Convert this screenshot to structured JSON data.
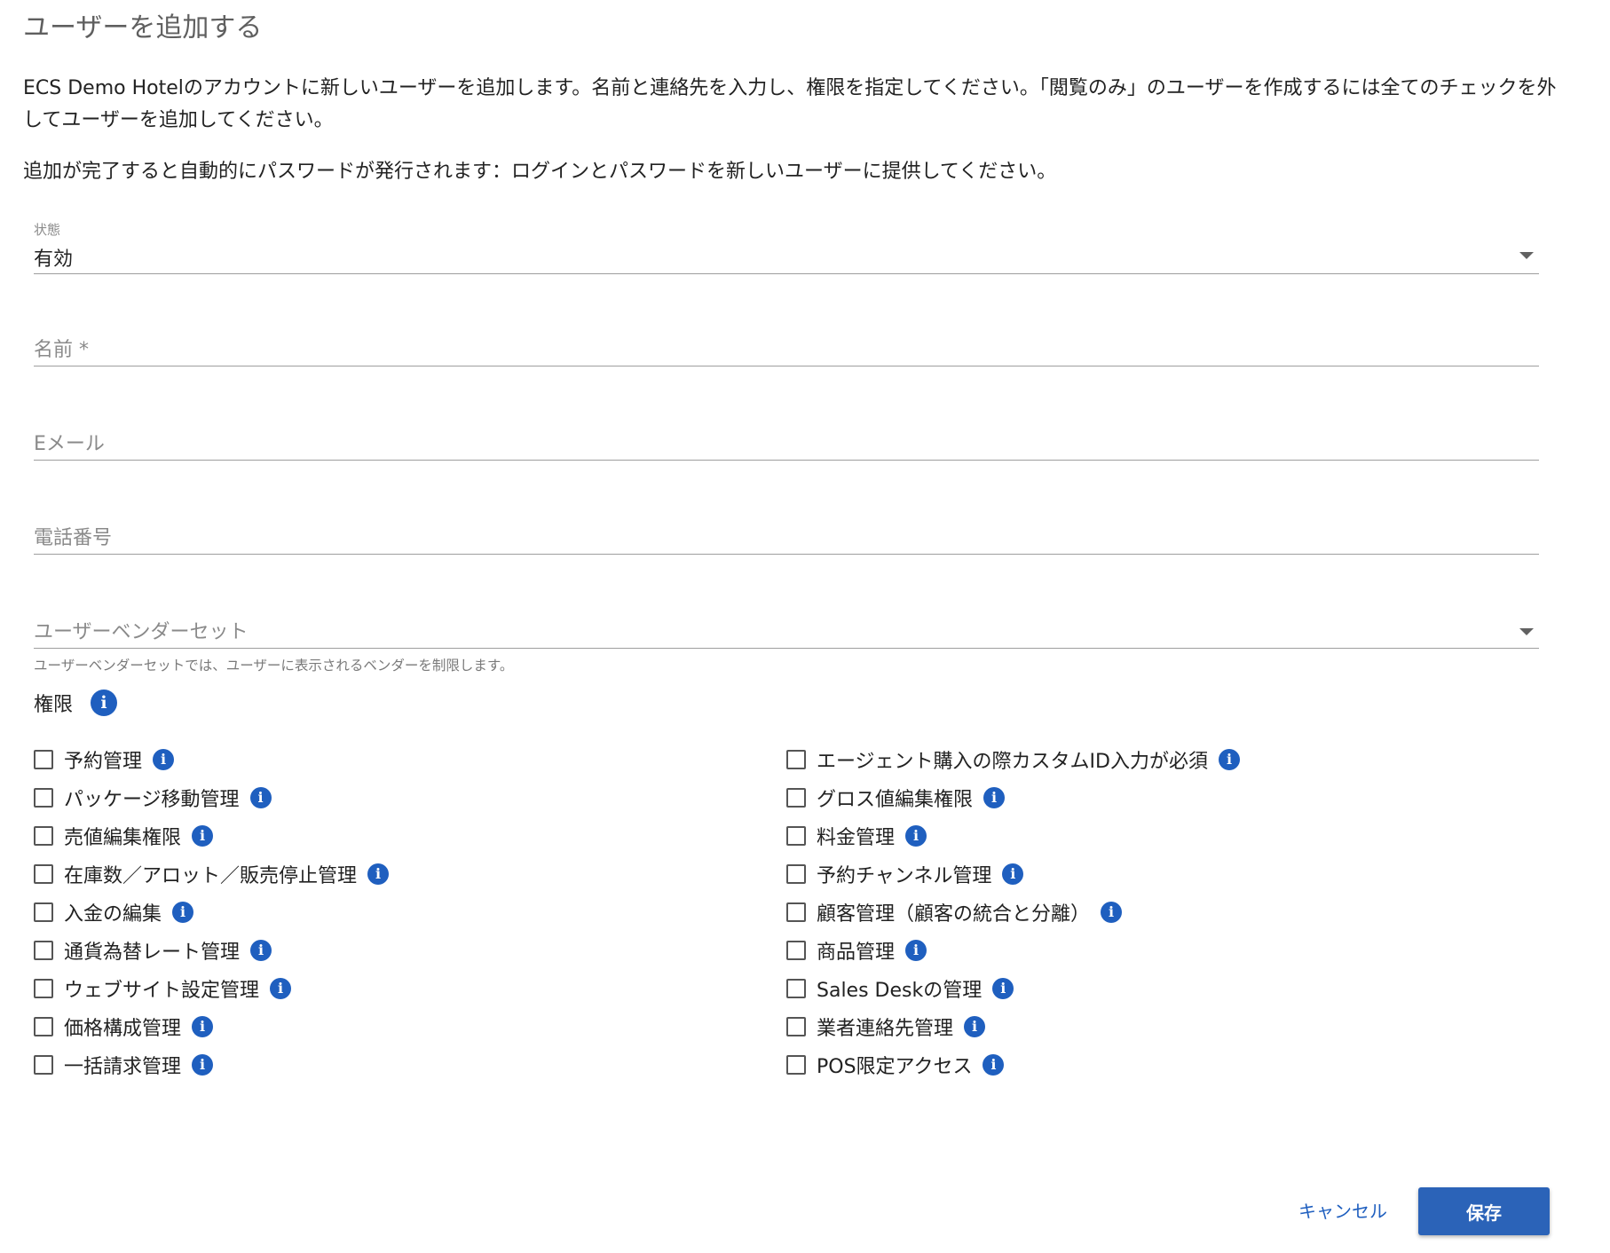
{
  "dialog": {
    "title": "ユーザーを追加する",
    "description_1": "ECS Demo Hotelのアカウントに新しいユーザーを追加します。名前と連絡先を入力し、権限を指定してください。「閲覧のみ」のユーザーを作成するには全てのチェックを外してユーザーを追加してください。",
    "description_2": "追加が完了すると自動的にパスワードが発行されます：ログインとパスワードを新しいユーザーに提供してください。"
  },
  "form": {
    "status": {
      "label": "状態",
      "value": "有効"
    },
    "name": {
      "placeholder": "名前 *",
      "value": ""
    },
    "email": {
      "placeholder": "Eメール",
      "value": ""
    },
    "phone": {
      "placeholder": "電話番号",
      "value": ""
    },
    "vendor_set": {
      "placeholder": "ユーザーベンダーセット",
      "hint": "ユーザーベンダーセットでは、ユーザーに表示されるベンダーを制限します。"
    }
  },
  "permissions": {
    "label": "権限",
    "left": [
      {
        "label": "予約管理",
        "checked": false
      },
      {
        "label": "パッケージ移動管理",
        "checked": false
      },
      {
        "label": "売値編集権限",
        "checked": false
      },
      {
        "label": "在庫数／アロット／販売停止管理",
        "checked": false
      },
      {
        "label": "入金の編集",
        "checked": false
      },
      {
        "label": "通貨為替レート管理",
        "checked": false
      },
      {
        "label": "ウェブサイト設定管理",
        "checked": false
      },
      {
        "label": "価格構成管理",
        "checked": false
      },
      {
        "label": "一括請求管理",
        "checked": false
      }
    ],
    "right": [
      {
        "label": "エージェント購入の際カスタムID入力が必須",
        "checked": false
      },
      {
        "label": "グロス値編集権限",
        "checked": false
      },
      {
        "label": "料金管理",
        "checked": false
      },
      {
        "label": "予約チャンネル管理",
        "checked": false
      },
      {
        "label": "顧客管理（顧客の統合と分離）",
        "checked": false
      },
      {
        "label": "商品管理",
        "checked": false
      },
      {
        "label": "Sales Deskの管理",
        "checked": false
      },
      {
        "label": "業者連絡先管理",
        "checked": false
      },
      {
        "label": "POS限定アクセス",
        "checked": false
      }
    ]
  },
  "actions": {
    "cancel_label": "キャンセル",
    "save_label": "保存"
  },
  "icons": {
    "info": "i"
  },
  "colors": {
    "accent": "#2b63b8",
    "info_icon": "#1f5fbf"
  }
}
